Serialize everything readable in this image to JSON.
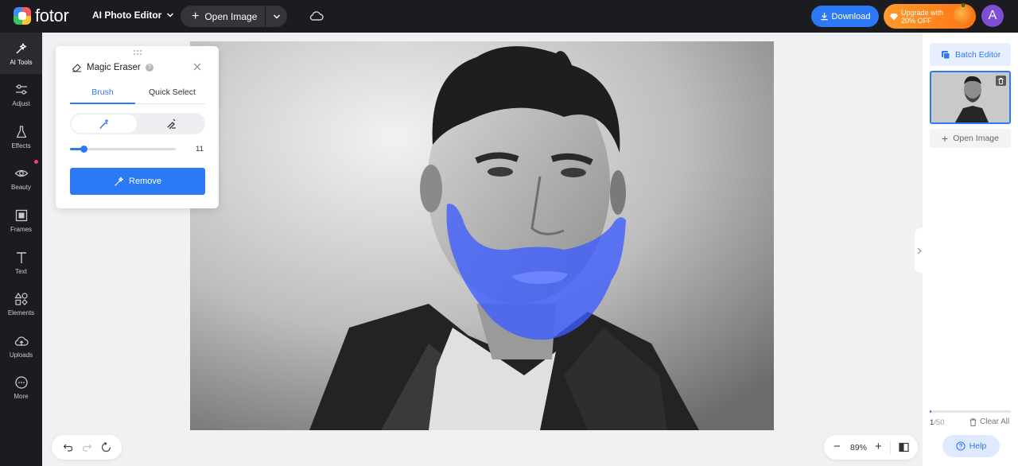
{
  "header": {
    "logo_text": "fotor",
    "app_menu_label": "AI Photo Editor",
    "open_image_label": "Open Image",
    "download_label": "Download",
    "upgrade_line1": "Upgrade with",
    "upgrade_line2": "20% OFF",
    "avatar_initial": "A"
  },
  "sidebar": {
    "items": [
      {
        "label": "AI Tools",
        "icon": "sparkle-wand-icon"
      },
      {
        "label": "Adjust",
        "icon": "sliders-icon"
      },
      {
        "label": "Effects",
        "icon": "flask-icon"
      },
      {
        "label": "Beauty",
        "icon": "eye-icon"
      },
      {
        "label": "Frames",
        "icon": "frame-icon"
      },
      {
        "label": "Text",
        "icon": "text-icon"
      },
      {
        "label": "Elements",
        "icon": "shapes-icon"
      },
      {
        "label": "Uploads",
        "icon": "cloud-upload-icon"
      },
      {
        "label": "More",
        "icon": "more-dots-icon"
      }
    ]
  },
  "magic_eraser": {
    "title": "Magic Eraser",
    "tabs": [
      "Brush",
      "Quick Select"
    ],
    "active_tab": "Brush",
    "brush_size": "11",
    "brush_fraction": 0.13,
    "remove_label": "Remove"
  },
  "right_panel": {
    "batch_editor_label": "Batch Editor",
    "open_image_label": "Open Image",
    "count_current": "1",
    "count_total": "/50",
    "progress_fraction": 0.02,
    "clear_all_label": "Clear All",
    "help_label": "Help"
  },
  "zoom": {
    "value": "89%"
  },
  "colors": {
    "accent": "#2c79f5",
    "brush_mask": "#3b5cff",
    "topbar": "#1b1c20",
    "upgrade": "#ff8a1f"
  }
}
